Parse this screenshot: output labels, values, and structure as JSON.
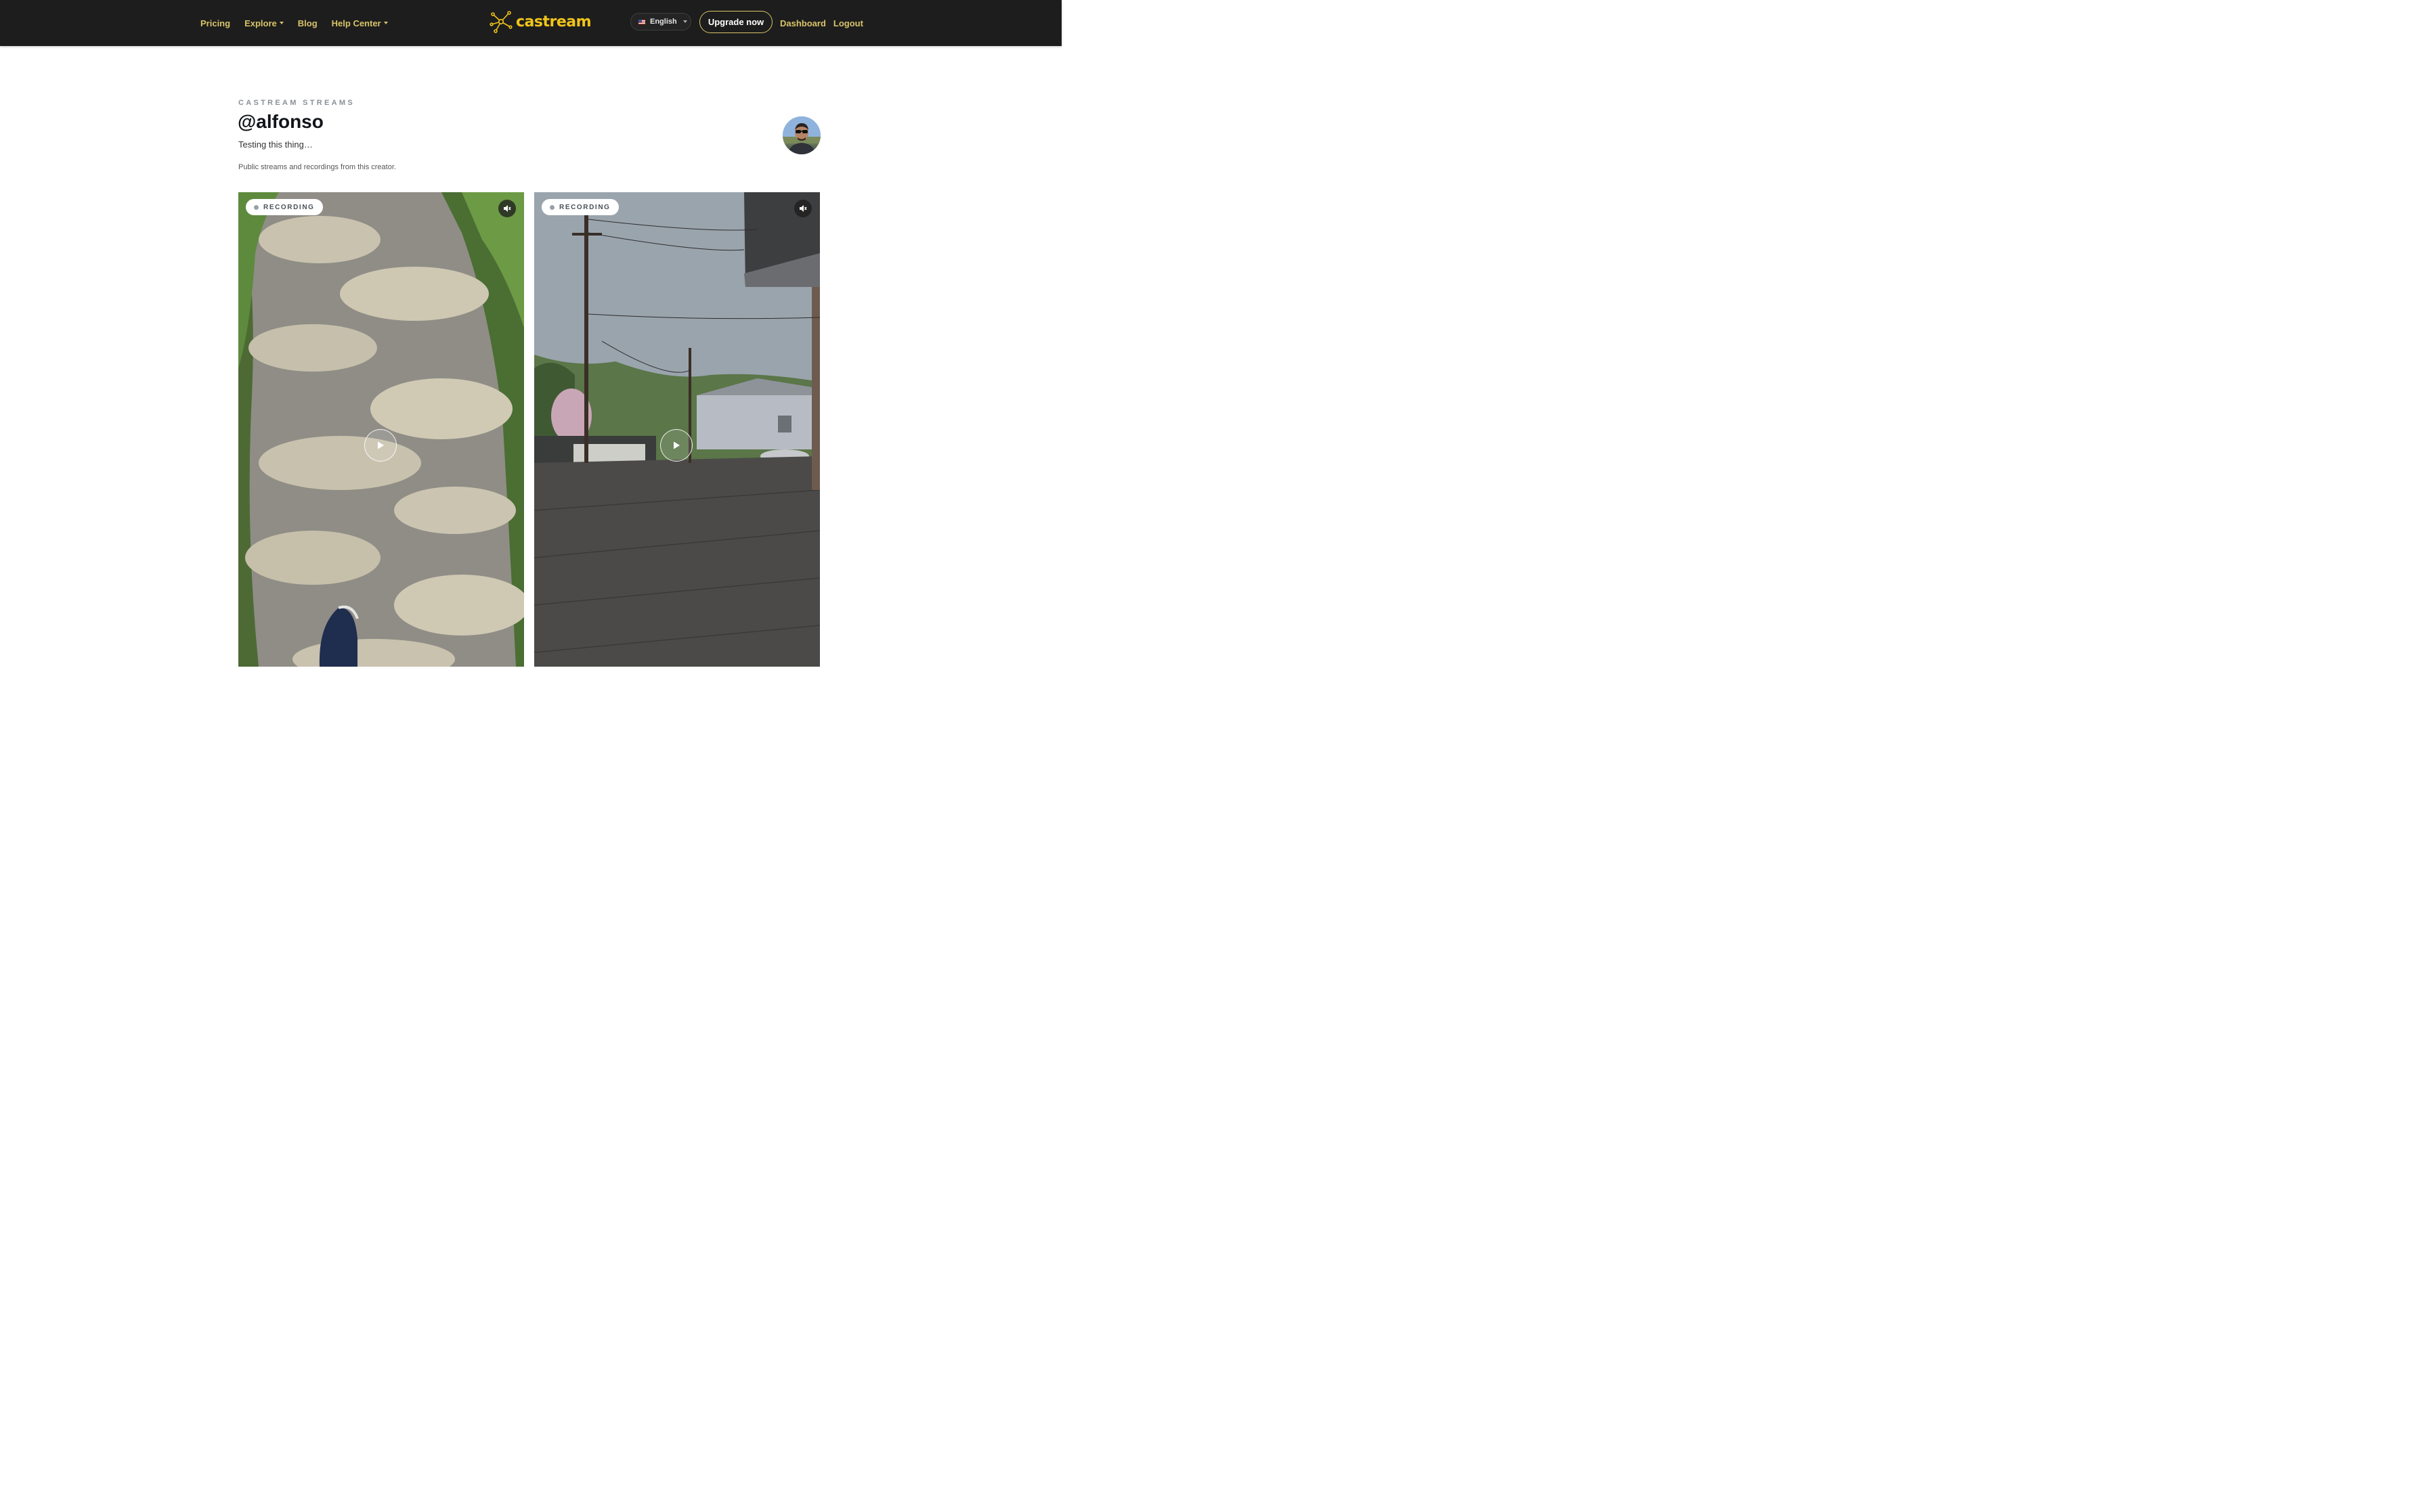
{
  "navbar": {
    "links_left": [
      {
        "label": "Pricing",
        "has_dropdown": false
      },
      {
        "label": "Explore",
        "has_dropdown": true
      },
      {
        "label": "Blog",
        "has_dropdown": false
      },
      {
        "label": "Help Center",
        "has_dropdown": true
      }
    ],
    "logo_text": "castream",
    "language": {
      "label": "English",
      "flag": "us-flag-icon"
    },
    "upgrade_label": "Upgrade now",
    "links_right": [
      "Dashboard",
      "Logout"
    ],
    "colors": {
      "background": "#1d1d1d",
      "link": "#d8c46a",
      "logo": "#f0c419"
    }
  },
  "profile": {
    "eyebrow": "CASTREAM STREAMS",
    "handle": "@alfonso",
    "bio": "Testing this thing…",
    "description": "Public streams and recordings from this creator."
  },
  "streams": [
    {
      "badge": "RECORDING",
      "icons": [
        "mute-icon",
        "play-icon"
      ]
    },
    {
      "badge": "RECORDING",
      "icons": [
        "mute-icon",
        "play-icon"
      ]
    }
  ]
}
